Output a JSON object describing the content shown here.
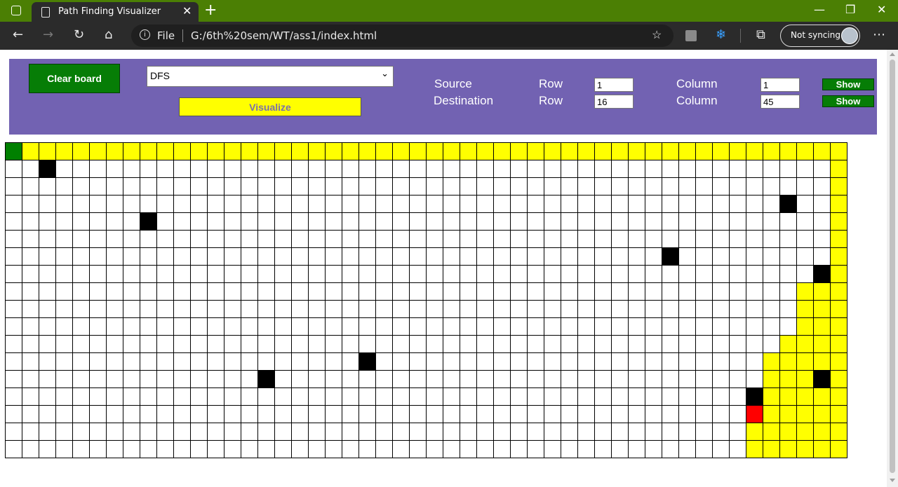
{
  "browser": {
    "tab_title": "Path Finding Visualizer",
    "tab_close": "✕",
    "new_tab": "+",
    "address_scheme": "File",
    "address_url": "G:/6th%20sem/WT/ass1/index.html",
    "sync_label": "Not syncing",
    "icons": [
      "workspaces-icon",
      "back-icon",
      "forward-icon",
      "refresh-icon",
      "home-icon",
      "info-icon",
      "favorite-icon",
      "extension-icon",
      "extension-icon",
      "collections-icon",
      "more-icon"
    ],
    "window_controls": {
      "minimize": "—",
      "maximize": "❐",
      "close": "✕"
    }
  },
  "controls": {
    "clear_label": "Clear board",
    "algorithm_selected": "DFS",
    "visualize_label": "Visualize",
    "source_label": "Source",
    "destination_label": "Destination",
    "row_label": "Row",
    "column_label": "Column",
    "source_row": "1",
    "source_col": "1",
    "dest_row": "16",
    "dest_col": "45",
    "show_label": "Show"
  },
  "grid": {
    "rows": 18,
    "cols": 50,
    "source": [
      1,
      1
    ],
    "destination": [
      16,
      45
    ],
    "walls": [
      [
        2,
        3
      ],
      [
        4,
        47
      ],
      [
        5,
        9
      ],
      [
        7,
        40
      ],
      [
        8,
        49
      ],
      [
        13,
        22
      ],
      [
        14,
        16
      ],
      [
        14,
        49
      ],
      [
        15,
        45
      ]
    ],
    "path_cells": [
      [
        1,
        2
      ],
      [
        1,
        3
      ],
      [
        1,
        4
      ],
      [
        1,
        5
      ],
      [
        1,
        6
      ],
      [
        1,
        7
      ],
      [
        1,
        8
      ],
      [
        1,
        9
      ],
      [
        1,
        10
      ],
      [
        1,
        11
      ],
      [
        1,
        12
      ],
      [
        1,
        13
      ],
      [
        1,
        14
      ],
      [
        1,
        15
      ],
      [
        1,
        16
      ],
      [
        1,
        17
      ],
      [
        1,
        18
      ],
      [
        1,
        19
      ],
      [
        1,
        20
      ],
      [
        1,
        21
      ],
      [
        1,
        22
      ],
      [
        1,
        23
      ],
      [
        1,
        24
      ],
      [
        1,
        25
      ],
      [
        1,
        26
      ],
      [
        1,
        27
      ],
      [
        1,
        28
      ],
      [
        1,
        29
      ],
      [
        1,
        30
      ],
      [
        1,
        31
      ],
      [
        1,
        32
      ],
      [
        1,
        33
      ],
      [
        1,
        34
      ],
      [
        1,
        35
      ],
      [
        1,
        36
      ],
      [
        1,
        37
      ],
      [
        1,
        38
      ],
      [
        1,
        39
      ],
      [
        1,
        40
      ],
      [
        1,
        41
      ],
      [
        1,
        42
      ],
      [
        1,
        43
      ],
      [
        1,
        44
      ],
      [
        1,
        45
      ],
      [
        1,
        46
      ],
      [
        1,
        47
      ],
      [
        1,
        48
      ],
      [
        1,
        49
      ],
      [
        1,
        50
      ],
      [
        2,
        50
      ],
      [
        3,
        50
      ],
      [
        4,
        50
      ],
      [
        5,
        50
      ],
      [
        6,
        50
      ],
      [
        7,
        50
      ],
      [
        8,
        50
      ],
      [
        9,
        48
      ],
      [
        9,
        49
      ],
      [
        9,
        50
      ],
      [
        10,
        48
      ],
      [
        10,
        49
      ],
      [
        10,
        50
      ],
      [
        11,
        48
      ],
      [
        11,
        49
      ],
      [
        11,
        50
      ],
      [
        12,
        47
      ],
      [
        12,
        48
      ],
      [
        12,
        49
      ],
      [
        12,
        50
      ],
      [
        13,
        46
      ],
      [
        13,
        47
      ],
      [
        13,
        48
      ],
      [
        13,
        49
      ],
      [
        13,
        50
      ],
      [
        14,
        46
      ],
      [
        14,
        47
      ],
      [
        14,
        48
      ],
      [
        14,
        50
      ],
      [
        15,
        46
      ],
      [
        15,
        47
      ],
      [
        15,
        48
      ],
      [
        15,
        49
      ],
      [
        15,
        50
      ],
      [
        16,
        46
      ],
      [
        16,
        47
      ],
      [
        16,
        48
      ],
      [
        16,
        49
      ],
      [
        16,
        50
      ],
      [
        17,
        45
      ],
      [
        17,
        46
      ],
      [
        17,
        47
      ],
      [
        17,
        48
      ],
      [
        17,
        49
      ],
      [
        17,
        50
      ],
      [
        18,
        45
      ],
      [
        18,
        46
      ],
      [
        18,
        47
      ],
      [
        18,
        48
      ],
      [
        18,
        49
      ],
      [
        18,
        50
      ]
    ],
    "colors": {
      "path": "#ffff00",
      "wall": "#000000",
      "source": "#008000",
      "destination": "#ff0000",
      "panel": "#7262b2"
    }
  }
}
